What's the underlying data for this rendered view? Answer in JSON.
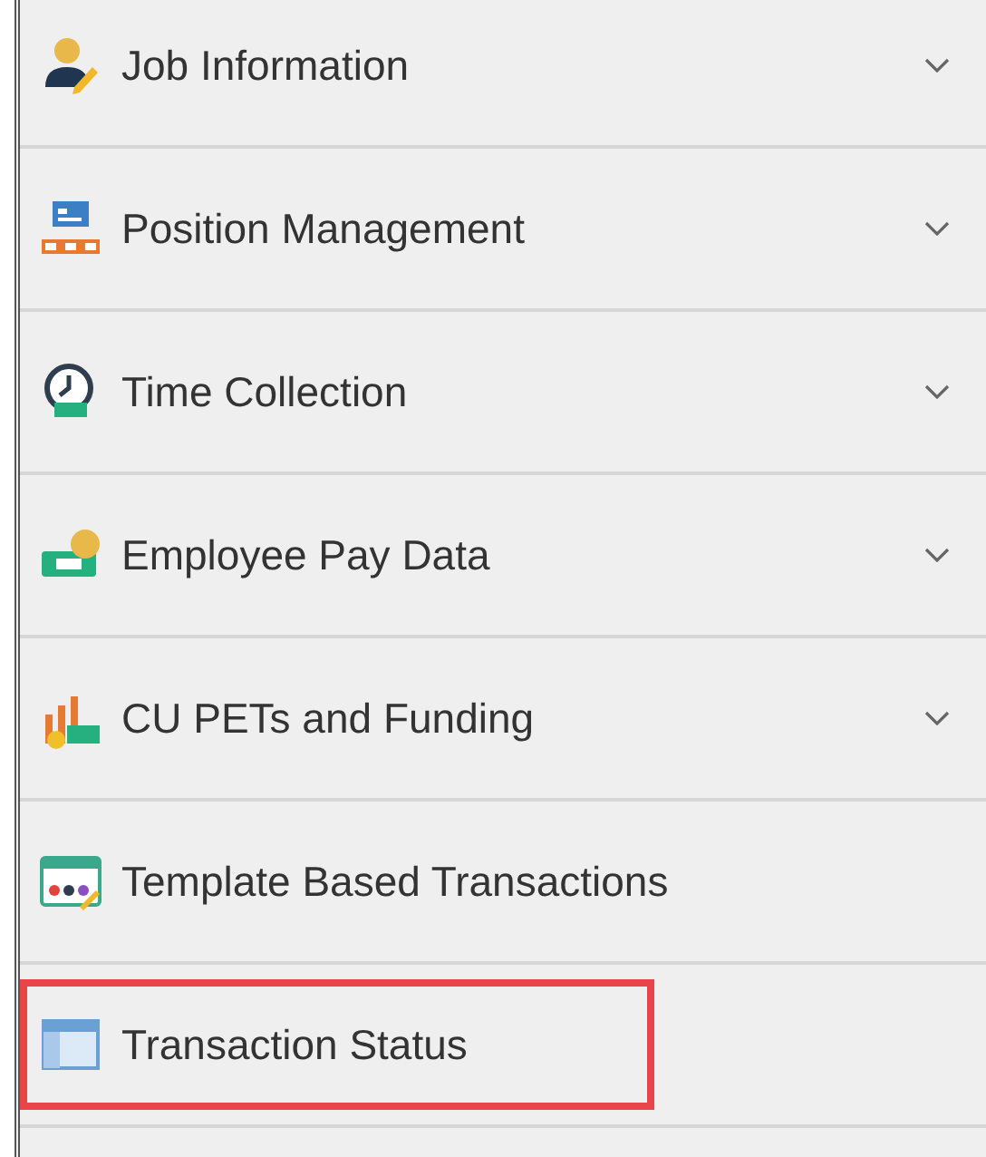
{
  "menu": [
    {
      "label": "Job Information",
      "expandable": true,
      "highlighted": false
    },
    {
      "label": "Position Management",
      "expandable": true,
      "highlighted": false
    },
    {
      "label": "Time Collection",
      "expandable": true,
      "highlighted": false
    },
    {
      "label": "Employee Pay Data",
      "expandable": true,
      "highlighted": false
    },
    {
      "label": "CU PETs and Funding",
      "expandable": true,
      "highlighted": false
    },
    {
      "label": "Template Based Transactions",
      "expandable": false,
      "highlighted": false
    },
    {
      "label": "Transaction Status",
      "expandable": false,
      "highlighted": true
    }
  ]
}
